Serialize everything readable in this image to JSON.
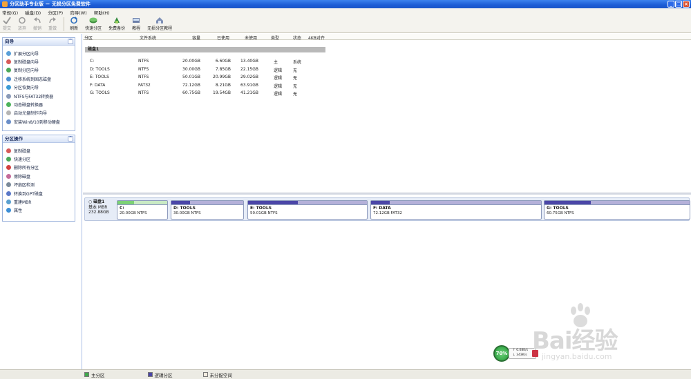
{
  "app": {
    "title": "分区助手专业版 － 无损分区免费软件"
  },
  "window_buttons": {
    "minimize": "_",
    "maximize": "□",
    "close": "×"
  },
  "menu": [
    "常规(G)",
    "磁盘(D)",
    "分区(P)",
    "向导(W)",
    "帮助(H)"
  ],
  "toolbar": [
    {
      "label": "提交",
      "icon": "check-icon",
      "enabled": false
    },
    {
      "label": "放弃",
      "icon": "discard-icon",
      "enabled": false
    },
    {
      "label": "撤销",
      "icon": "undo-icon",
      "enabled": false
    },
    {
      "label": "重做",
      "icon": "redo-icon",
      "enabled": false
    },
    {
      "label": "刷新",
      "icon": "refresh-icon",
      "enabled": true
    },
    {
      "label": "快速分区",
      "icon": "quick-partition-icon",
      "enabled": true
    },
    {
      "label": "免费备份",
      "icon": "backup-icon",
      "enabled": true
    },
    {
      "label": "教程",
      "icon": "tutorial-icon",
      "enabled": true
    },
    {
      "label": "无损分区教程",
      "icon": "lossless-tutorial-icon",
      "enabled": true
    }
  ],
  "wizard_panel": {
    "title": "向导",
    "items": [
      "扩展分区向导",
      "复制磁盘向导",
      "复制分区向导",
      "迁移系统到固态磁盘",
      "分区恢复向导",
      "NTFS与FAT32转换器",
      "动态磁盘转换器",
      "启动光盘制作向导",
      "安装Win8/10到移动硬盘"
    ]
  },
  "partition_ops_panel": {
    "title": "分区操作",
    "items": [
      "复制磁盘",
      "快速分区",
      "删除所有分区",
      "擦除磁盘",
      "坏扇区检测",
      "转换到GPT磁盘",
      "重建MBR",
      "属性"
    ]
  },
  "table": {
    "headers": [
      "分区",
      "文件系统",
      "容量",
      "已使用",
      "未使用",
      "类型",
      "状态",
      "4KB对齐"
    ],
    "disk_label": "磁盘1",
    "rows": [
      {
        "name": "C:",
        "fs": "NTFS",
        "capacity": "20.00GB",
        "used": "6.60GB",
        "unused": "13.40GB",
        "type": "主",
        "status": "系统"
      },
      {
        "name": "D: TOOLS",
        "fs": "NTFS",
        "capacity": "30.00GB",
        "used": "7.85GB",
        "unused": "22.15GB",
        "type": "逻辑",
        "status": "无"
      },
      {
        "name": "E: TOOLS",
        "fs": "NTFS",
        "capacity": "50.01GB",
        "used": "20.99GB",
        "unused": "29.02GB",
        "type": "逻辑",
        "status": "无"
      },
      {
        "name": "F: DATA",
        "fs": "FAT32",
        "capacity": "72.12GB",
        "used": "8.21GB",
        "unused": "63.91GB",
        "type": "逻辑",
        "status": "无"
      },
      {
        "name": "G: TOOLS",
        "fs": "NTFS",
        "capacity": "60.75GB",
        "used": "19.54GB",
        "unused": "41.21GB",
        "type": "逻辑",
        "status": "无"
      }
    ]
  },
  "disk_map": {
    "disk_name": "磁盘1",
    "disk_type": "基本 MBR",
    "disk_size": "232.88GB",
    "partitions": [
      {
        "name": "C:",
        "detail": "20.00GB NTFS",
        "used_fraction": 0.33,
        "color": "#7cd174"
      },
      {
        "name": "D: TOOLS",
        "detail": "30.00GB NTFS",
        "used_fraction": 0.26,
        "color": "#4b46a8"
      },
      {
        "name": "E: TOOLS",
        "detail": "50.01GB NTFS",
        "used_fraction": 0.42,
        "color": "#4b46a8"
      },
      {
        "name": "F: DATA",
        "detail": "72.12GB FAT32",
        "used_fraction": 0.11,
        "color": "#4b46a8"
      },
      {
        "name": "G: TOOLS",
        "detail": "60.75GB NTFS",
        "used_fraction": 0.32,
        "color": "#4b46a8"
      }
    ]
  },
  "legend": [
    {
      "label": "主分区",
      "color": "#3fa84a"
    },
    {
      "label": "逻辑分区",
      "color": "#4b46a8"
    },
    {
      "label": "未分配空间",
      "color": "#f3ece0"
    }
  ],
  "net_widget": {
    "percent": "70%",
    "up": "0.08K/s",
    "down": "343K/s"
  },
  "watermark": {
    "brand": "Bai经验",
    "url": "jingyan.baidu.com"
  }
}
